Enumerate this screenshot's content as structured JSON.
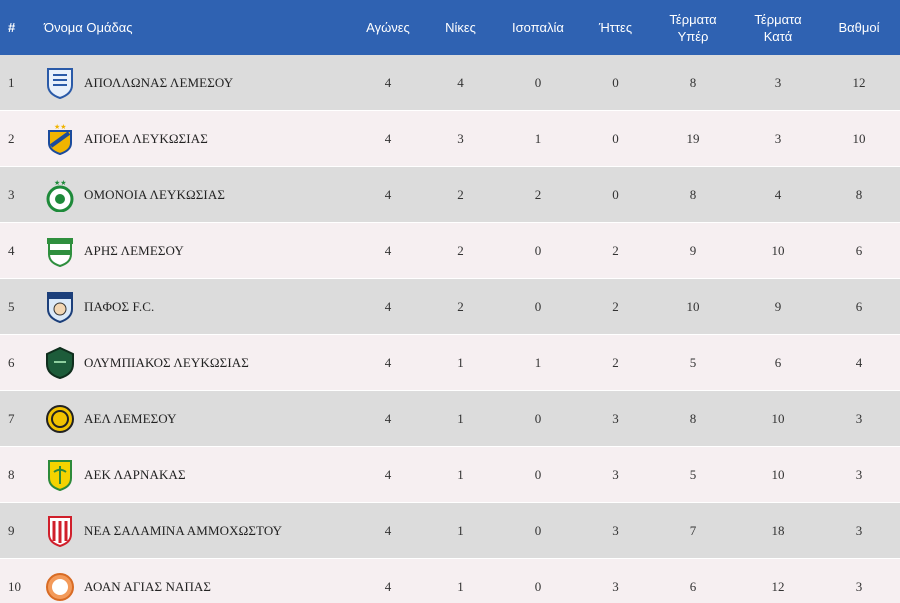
{
  "table": {
    "headers": {
      "pos": "#",
      "team": "Όνομα Ομάδας",
      "played": "Αγώνες",
      "wins": "Νίκες",
      "draws": "Ισοπαλία",
      "losses": "Ήττες",
      "goals_for_line1": "Τέρματα",
      "goals_for_line2": "Υπέρ",
      "goals_against_line1": "Τέρματα",
      "goals_against_line2": "Κατά",
      "points": "Βαθμοί"
    },
    "rows": [
      {
        "pos": "1",
        "team": "ΑΠΟΛΛΩΝΑΣ ΛΕΜΕΣΟΥ",
        "logo": "apollon-logo-icon",
        "played": "4",
        "wins": "4",
        "draws": "0",
        "losses": "0",
        "gf": "8",
        "ga": "3",
        "pts": "12"
      },
      {
        "pos": "2",
        "team": "ΑΠΟΕΛ ΛΕΥΚΩΣΙΑΣ",
        "logo": "apoel-logo-icon",
        "played": "4",
        "wins": "3",
        "draws": "1",
        "losses": "0",
        "gf": "19",
        "ga": "3",
        "pts": "10"
      },
      {
        "pos": "3",
        "team": "ΟΜΟΝΟΙΑ ΛΕΥΚΩΣΙΑΣ",
        "logo": "omonoia-logo-icon",
        "played": "4",
        "wins": "2",
        "draws": "2",
        "losses": "0",
        "gf": "8",
        "ga": "4",
        "pts": "8"
      },
      {
        "pos": "4",
        "team": "ΑΡΗΣ ΛΕΜΕΣΟΥ",
        "logo": "aris-logo-icon",
        "played": "4",
        "wins": "2",
        "draws": "0",
        "losses": "2",
        "gf": "9",
        "ga": "10",
        "pts": "6"
      },
      {
        "pos": "5",
        "team": "ΠΑΦΟΣ F.C.",
        "logo": "pafos-logo-icon",
        "played": "4",
        "wins": "2",
        "draws": "0",
        "losses": "2",
        "gf": "10",
        "ga": "9",
        "pts": "6"
      },
      {
        "pos": "6",
        "team": "ΟΛΥΜΠΙΑΚΟΣ ΛΕΥΚΩΣΙΑΣ",
        "logo": "olympiakos-logo-icon",
        "played": "4",
        "wins": "1",
        "draws": "1",
        "losses": "2",
        "gf": "5",
        "ga": "6",
        "pts": "4"
      },
      {
        "pos": "7",
        "team": "ΑΕΛ ΛΕΜΕΣΟΥ",
        "logo": "ael-logo-icon",
        "played": "4",
        "wins": "1",
        "draws": "0",
        "losses": "3",
        "gf": "8",
        "ga": "10",
        "pts": "3"
      },
      {
        "pos": "8",
        "team": "ΑΕΚ ΛΑΡΝΑΚΑΣ",
        "logo": "aek-logo-icon",
        "played": "4",
        "wins": "1",
        "draws": "0",
        "losses": "3",
        "gf": "5",
        "ga": "10",
        "pts": "3"
      },
      {
        "pos": "9",
        "team": "ΝΕΑ ΣΑΛΑΜΙΝΑ ΑΜΜΟΧΩΣΤΟΥ",
        "logo": "nea-salamina-logo-icon",
        "played": "4",
        "wins": "1",
        "draws": "0",
        "losses": "3",
        "gf": "7",
        "ga": "18",
        "pts": "3"
      },
      {
        "pos": "10",
        "team": "ΑΟΑΝ ΑΓΙΑΣ ΝΑΠΑΣ",
        "logo": "aoan-logo-icon",
        "played": "4",
        "wins": "1",
        "draws": "0",
        "losses": "3",
        "gf": "6",
        "ga": "12",
        "pts": "3"
      }
    ]
  },
  "colors": {
    "header_bg": "#2f62b2",
    "row_odd": "#dcdcdc",
    "row_even": "#f6eff1"
  }
}
